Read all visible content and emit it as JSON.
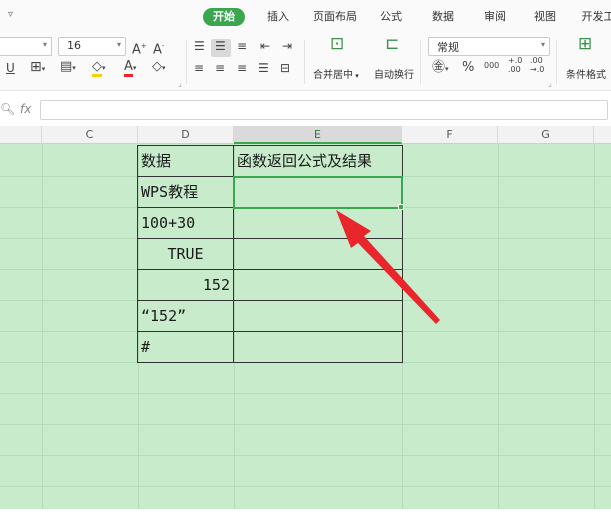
{
  "tabs": [
    "开始",
    "插入",
    "页面布局",
    "公式",
    "数据",
    "审阅",
    "视图",
    "开发工"
  ],
  "toolbar": {
    "font_size": "16",
    "number_format": "常规",
    "merge_label": "合并居中",
    "wrap_label": "自动换行",
    "cond_label": "条件格式",
    "percent": "%",
    "thousands": "000"
  },
  "formula_bar": {
    "fx": "fx",
    "value": ""
  },
  "columns": [
    "C",
    "D",
    "E",
    "F",
    "G"
  ],
  "active_column": "E",
  "cells": {
    "D1": "数据",
    "E1": "函数返回公式及结果",
    "D2": "WPS教程",
    "D3": "100+30",
    "D4": "TRUE",
    "D5": "152",
    "D6": "“152”",
    "D7": "#"
  },
  "colors": {
    "accent": "#3aa64d",
    "sheet_bg": "#c7ebcb",
    "arrow": "#e8262b"
  }
}
